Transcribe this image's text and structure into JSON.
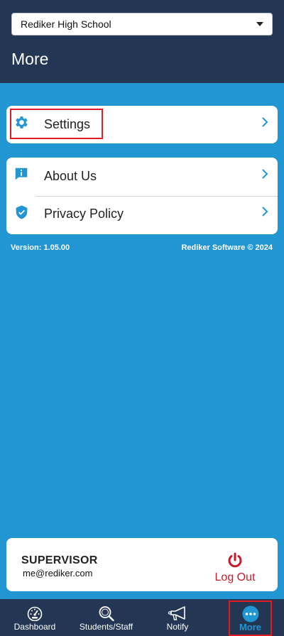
{
  "header": {
    "school_select": {
      "value": "Rediker High School"
    },
    "title": "More"
  },
  "menu": {
    "settings": {
      "label": "Settings",
      "icon": "gear-icon"
    },
    "about": {
      "label": "About Us",
      "icon": "info-icon"
    },
    "privacy": {
      "label": "Privacy Policy",
      "icon": "shield-icon"
    }
  },
  "footer_info": {
    "version": "Version: 1.05.00",
    "copyright": "Rediker Software © 2024"
  },
  "user": {
    "role": "SUPERVISOR",
    "email": "me@rediker.com",
    "logout_label": "Log Out"
  },
  "tabbar": {
    "tabs": [
      {
        "label": "Dashboard",
        "icon": "dashboard-icon",
        "active": false
      },
      {
        "label": "Students/Staff",
        "icon": "search-icon",
        "active": false
      },
      {
        "label": "Notify",
        "icon": "megaphone-icon",
        "active": false
      },
      {
        "label": "More",
        "icon": "more-icon",
        "active": true
      }
    ]
  },
  "colors": {
    "background": "#2196d3",
    "header": "#233755",
    "accent": "#2196d3",
    "danger": "#c9192c",
    "highlight": "#e01b24"
  }
}
